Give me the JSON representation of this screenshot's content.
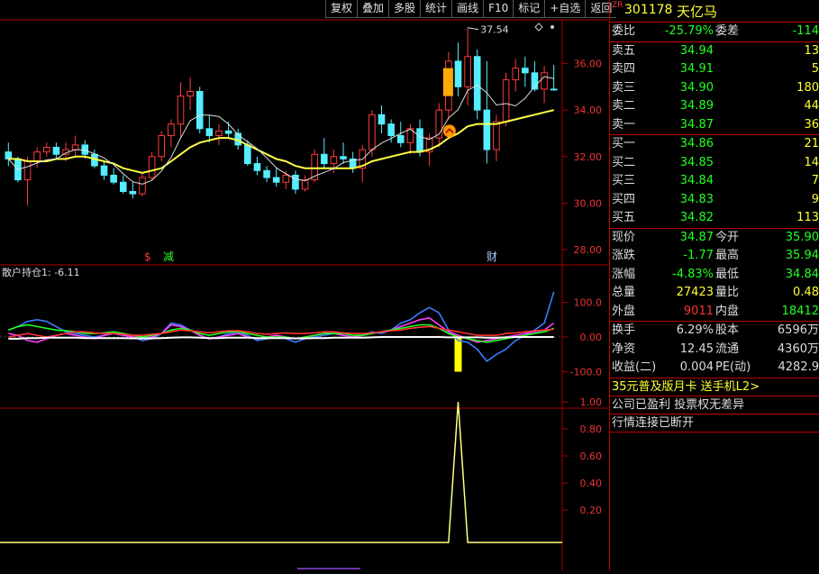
{
  "toolbar": {
    "buttons": [
      "复权",
      "叠加",
      "多股",
      "统计",
      "画线",
      "F10",
      "标记",
      "+自选",
      "返回"
    ]
  },
  "main_chart": {
    "y_ticks": [
      "36.00",
      "34.00",
      "32.00",
      "30.00",
      "28.00"
    ],
    "high_annotation": "37.54",
    "markers": {
      "s": "$",
      "jian": "减",
      "cai": "财"
    },
    "colors": {
      "up": "#ff3b3b",
      "down": "#55eeff",
      "ma": "#ffff44"
    }
  },
  "indicator1": {
    "title": "散户持仓1: -6.11",
    "y_ticks": [
      "100.0",
      "0.00",
      "-100.0"
    ],
    "series_colors": [
      "#3a7bff",
      "#ff40ff",
      "#22ff22",
      "#ff3333",
      "#ffffff"
    ]
  },
  "indicator2": {
    "y_ticks": [
      "1.00",
      "0.80",
      "0.60",
      "0.40",
      "0.20"
    ],
    "series_color": "#ffff80"
  },
  "chart_data": {
    "type": "candlestick",
    "price_ylim": [
      27.5,
      37.8
    ],
    "candles": [
      [
        32.2,
        32.6,
        31.6,
        31.9
      ],
      [
        31.9,
        32.0,
        30.9,
        31.0
      ],
      [
        31.0,
        32.0,
        29.9,
        31.8
      ],
      [
        31.8,
        32.4,
        31.5,
        32.2
      ],
      [
        32.2,
        32.6,
        32.0,
        32.4
      ],
      [
        32.4,
        32.6,
        31.9,
        32.1
      ],
      [
        32.1,
        32.6,
        31.8,
        32.3
      ],
      [
        32.3,
        32.9,
        32.0,
        32.5
      ],
      [
        32.5,
        32.7,
        31.9,
        32.1
      ],
      [
        32.1,
        32.3,
        31.5,
        31.6
      ],
      [
        31.6,
        31.8,
        31.0,
        31.2
      ],
      [
        31.2,
        31.5,
        30.8,
        30.9
      ],
      [
        30.9,
        31.2,
        30.4,
        30.5
      ],
      [
        30.5,
        30.9,
        30.2,
        30.4
      ],
      [
        30.4,
        31.3,
        30.3,
        31.1
      ],
      [
        31.1,
        32.2,
        31.0,
        32.0
      ],
      [
        32.0,
        33.1,
        31.8,
        32.9
      ],
      [
        32.9,
        33.6,
        32.4,
        33.4
      ],
      [
        33.4,
        35.2,
        32.8,
        34.6
      ],
      [
        34.6,
        35.4,
        34.0,
        34.8
      ],
      [
        34.8,
        35.0,
        33.0,
        33.2
      ],
      [
        33.2,
        33.8,
        32.6,
        32.9
      ],
      [
        32.9,
        33.4,
        32.5,
        33.1
      ],
      [
        33.1,
        33.5,
        32.8,
        33.0
      ],
      [
        33.0,
        33.2,
        32.3,
        32.5
      ],
      [
        32.5,
        32.7,
        31.6,
        31.7
      ],
      [
        31.7,
        32.0,
        31.2,
        31.4
      ],
      [
        31.4,
        31.6,
        30.9,
        31.1
      ],
      [
        31.1,
        31.5,
        30.7,
        30.9
      ],
      [
        30.9,
        31.4,
        30.6,
        31.2
      ],
      [
        31.2,
        31.4,
        30.4,
        30.6
      ],
      [
        30.6,
        31.2,
        30.5,
        31.0
      ],
      [
        31.0,
        32.3,
        30.9,
        32.1
      ],
      [
        32.1,
        32.8,
        31.5,
        31.7
      ],
      [
        31.7,
        32.3,
        31.3,
        32.0
      ],
      [
        32.0,
        32.6,
        31.7,
        31.9
      ],
      [
        31.9,
        32.2,
        31.3,
        31.5
      ],
      [
        31.5,
        32.5,
        30.9,
        32.3
      ],
      [
        32.3,
        34.0,
        32.0,
        33.8
      ],
      [
        33.8,
        34.2,
        33.0,
        33.4
      ],
      [
        33.4,
        33.6,
        32.6,
        32.9
      ],
      [
        32.9,
        33.5,
        32.4,
        32.6
      ],
      [
        32.6,
        33.4,
        32.1,
        33.2
      ],
      [
        33.2,
        33.6,
        32.0,
        32.2
      ],
      [
        32.2,
        33.0,
        31.6,
        32.8
      ],
      [
        32.8,
        34.3,
        32.4,
        34.0
      ],
      [
        34.0,
        36.5,
        33.6,
        36.1
      ],
      [
        36.1,
        36.9,
        34.6,
        35.0
      ],
      [
        35.0,
        37.54,
        34.2,
        36.3
      ],
      [
        36.3,
        36.6,
        33.6,
        34.0
      ],
      [
        34.0,
        36.1,
        31.7,
        32.3
      ],
      [
        32.3,
        33.8,
        31.8,
        33.5
      ],
      [
        33.5,
        35.6,
        33.3,
        35.3
      ],
      [
        35.3,
        36.2,
        34.8,
        35.8
      ],
      [
        35.8,
        36.3,
        35.0,
        35.6
      ],
      [
        35.6,
        36.1,
        34.8,
        34.9
      ],
      [
        34.9,
        35.9,
        34.3,
        35.6
      ],
      [
        34.9,
        35.94,
        34.84,
        34.87
      ]
    ],
    "ma": [
      31.9,
      31.9,
      31.8,
      31.8,
      31.8,
      31.9,
      31.9,
      32.0,
      32.0,
      31.9,
      31.8,
      31.7,
      31.5,
      31.4,
      31.3,
      31.4,
      31.5,
      31.8,
      32.1,
      32.4,
      32.6,
      32.7,
      32.8,
      32.8,
      32.7,
      32.5,
      32.3,
      32.1,
      31.9,
      31.8,
      31.6,
      31.5,
      31.5,
      31.5,
      31.5,
      31.5,
      31.5,
      31.6,
      31.8,
      31.9,
      32.0,
      32.1,
      32.2,
      32.2,
      32.3,
      32.5,
      32.8,
      33.0,
      33.3,
      33.4,
      33.4,
      33.4,
      33.5,
      33.6,
      33.7,
      33.8,
      33.9,
      34.0
    ],
    "ind1": {
      "blue": [
        20,
        30,
        45,
        50,
        45,
        30,
        15,
        10,
        5,
        0,
        5,
        10,
        5,
        0,
        -10,
        -5,
        10,
        40,
        35,
        20,
        5,
        -5,
        0,
        10,
        15,
        5,
        -10,
        -5,
        0,
        -5,
        -15,
        -5,
        0,
        5,
        10,
        5,
        0,
        5,
        15,
        10,
        20,
        40,
        50,
        70,
        85,
        70,
        20,
        -10,
        -15,
        -35,
        -70,
        -50,
        -35,
        -10,
        5,
        20,
        40,
        130
      ],
      "pink": [
        10,
        5,
        -10,
        -15,
        -5,
        5,
        10,
        5,
        0,
        -5,
        5,
        10,
        5,
        0,
        -5,
        0,
        10,
        35,
        30,
        20,
        5,
        -5,
        0,
        5,
        10,
        0,
        -5,
        0,
        5,
        0,
        -5,
        0,
        5,
        10,
        10,
        5,
        0,
        5,
        10,
        15,
        20,
        30,
        40,
        50,
        55,
        35,
        15,
        5,
        -5,
        -15,
        -10,
        -5,
        0,
        5,
        10,
        15,
        20,
        40
      ],
      "green": [
        20,
        30,
        35,
        30,
        25,
        20,
        18,
        15,
        10,
        10,
        12,
        15,
        10,
        5,
        0,
        5,
        10,
        20,
        25,
        20,
        10,
        5,
        10,
        15,
        15,
        10,
        5,
        0,
        0,
        0,
        -5,
        0,
        5,
        10,
        10,
        10,
        5,
        5,
        10,
        15,
        20,
        25,
        30,
        35,
        35,
        25,
        10,
        0,
        -5,
        -10,
        -15,
        -10,
        -5,
        0,
        5,
        10,
        15,
        25
      ],
      "red": [
        0,
        5,
        10,
        5,
        0,
        5,
        10,
        15,
        15,
        12,
        10,
        10,
        8,
        5,
        5,
        8,
        10,
        15,
        20,
        18,
        15,
        12,
        15,
        18,
        18,
        15,
        10,
        8,
        10,
        12,
        10,
        10,
        12,
        15,
        15,
        12,
        10,
        10,
        12,
        15,
        18,
        20,
        25,
        28,
        30,
        25,
        20,
        15,
        10,
        5,
        5,
        5,
        10,
        12,
        15,
        18,
        20,
        22
      ],
      "white": [
        -5,
        -5,
        -3,
        -3,
        -2,
        -2,
        -2,
        -2,
        -3,
        -3,
        -3,
        -3,
        -3,
        -4,
        -4,
        -4,
        -3,
        -2,
        -1,
        -1,
        -2,
        -3,
        -3,
        -2,
        -2,
        -2,
        -3,
        -3,
        -3,
        -3,
        -4,
        -4,
        -3,
        -3,
        -2,
        -2,
        -2,
        -2,
        -1,
        0,
        0,
        0,
        0,
        0,
        0,
        0,
        -1,
        -1,
        -1,
        -1,
        -2,
        -2,
        -1,
        0,
        0,
        0,
        0,
        0
      ]
    },
    "ind1_bar": {
      "index": 47,
      "value": -100
    },
    "ind2": {
      "peak_index": 47,
      "peak_value": 1.0
    }
  },
  "quote": {
    "zr": "ZR",
    "code": "301178",
    "name": "天亿马",
    "weibi": {
      "label": "委比",
      "value": "-25.79%",
      "label2": "委差",
      "value2": "-114"
    },
    "asks": [
      {
        "label": "卖五",
        "price": "34.94",
        "vol": "13"
      },
      {
        "label": "卖四",
        "price": "34.91",
        "vol": "5"
      },
      {
        "label": "卖三",
        "price": "34.90",
        "vol": "180"
      },
      {
        "label": "卖二",
        "price": "34.89",
        "vol": "44"
      },
      {
        "label": "卖一",
        "price": "34.87",
        "vol": "36"
      }
    ],
    "bids": [
      {
        "label": "买一",
        "price": "34.86",
        "vol": "21"
      },
      {
        "label": "买二",
        "price": "34.85",
        "vol": "14"
      },
      {
        "label": "买三",
        "price": "34.84",
        "vol": "7"
      },
      {
        "label": "买四",
        "price": "34.83",
        "vol": "9"
      },
      {
        "label": "买五",
        "price": "34.82",
        "vol": "113"
      }
    ],
    "stats": [
      {
        "l1": "现价",
        "v1": "34.87",
        "c1": "g",
        "l2": "今开",
        "v2": "35.90",
        "c2": "g"
      },
      {
        "l1": "涨跌",
        "v1": "-1.77",
        "c1": "g",
        "l2": "最高",
        "v2": "35.94",
        "c2": "g"
      },
      {
        "l1": "涨幅",
        "v1": "-4.83%",
        "c1": "g",
        "l2": "最低",
        "v2": "34.84",
        "c2": "g"
      },
      {
        "l1": "总量",
        "v1": "27423",
        "c1": "y",
        "l2": "量比",
        "v2": "0.48",
        "c2": "y"
      },
      {
        "l1": "外盘",
        "v1": "9011",
        "c1": "r",
        "l2": "内盘",
        "v2": "18412",
        "c2": "g"
      }
    ],
    "fund": [
      {
        "l1": "换手",
        "v1": "6.29%",
        "l2": "股本",
        "v2": "6596万"
      },
      {
        "l1": "净资",
        "v1": "12.45",
        "l2": "流通",
        "v2": "4360万"
      },
      {
        "l1": "收益(二)",
        "v1": "0.004",
        "l2": "PE(动)",
        "v2": "4282.9"
      }
    ],
    "promo": "35元普及版月卡 送手机L2>",
    "notes": [
      "公司已盈利 投票权无差异",
      "行情连接已断开"
    ]
  }
}
